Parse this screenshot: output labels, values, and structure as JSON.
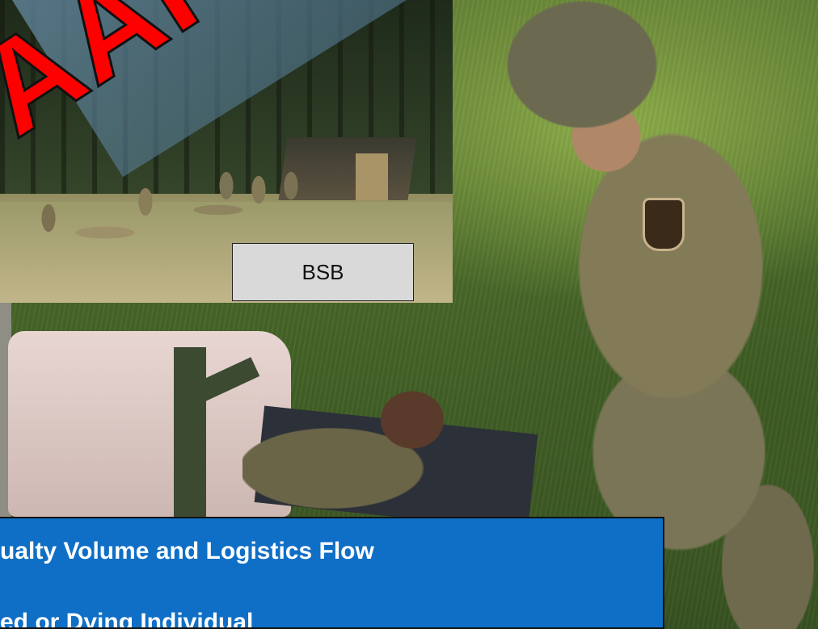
{
  "overlay_stamp": "AAR",
  "inset_photo_label": "BSB",
  "panel": {
    "line1": "ualty Volume and Logistics Flow",
    "line2": "ed or Dying Individual"
  }
}
